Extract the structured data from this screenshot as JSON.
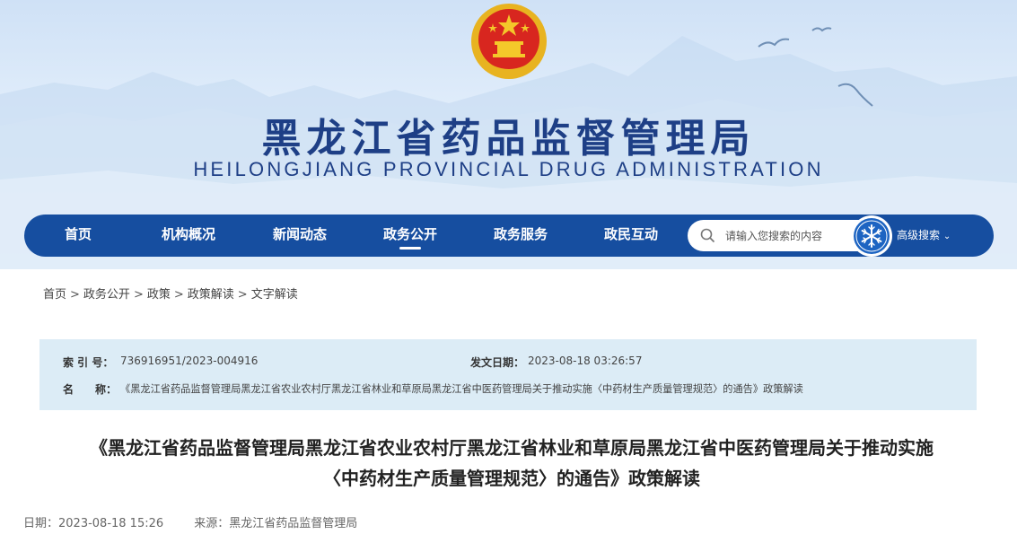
{
  "header": {
    "title": "黑龙江省药品监督管理局",
    "subtitle": "HEILONGJIANG PROVINCIAL DRUG ADMINISTRATION",
    "emblem": "national-emblem"
  },
  "nav": {
    "items": [
      {
        "label": "首页"
      },
      {
        "label": "机构概况"
      },
      {
        "label": "新闻动态"
      },
      {
        "label": "政务公开",
        "active": true
      },
      {
        "label": "政务服务"
      },
      {
        "label": "政民互动"
      }
    ],
    "search_placeholder": "请输入您搜索的内容",
    "advanced_search": "高级搜索"
  },
  "breadcrumb": [
    "首页",
    "政务公开",
    "政策",
    "政策解读",
    "文字解读"
  ],
  "breadcrumb_separator": ">",
  "info": {
    "index_label": "索 引 号：",
    "index_value": "736916951/2023-004916",
    "date_label": "发文日期：",
    "date_value": "2023-08-18 03:26:57",
    "name_label": "名　　称：",
    "name_value": "《黑龙江省药品监督管理局黑龙江省农业农村厅黑龙江省林业和草原局黑龙江省中医药管理局关于推动实施〈中药材生产质量管理规范〉的通告》政策解读"
  },
  "article": {
    "title_line1": "《黑龙江省药品监督管理局黑龙江省农业农村厅黑龙江省林业和草原局黑龙江省中医药管理局关于推动实施",
    "title_line2": "〈中药材生产质量管理规范〉的通告》政策解读",
    "date": "日期：2023-08-18 15:26",
    "source": "来源：黑龙江省药品监督管理局"
  },
  "colors": {
    "nav_bg": "#164ea0",
    "title_color": "#1e3f86",
    "info_bg": "#dcecf6"
  }
}
